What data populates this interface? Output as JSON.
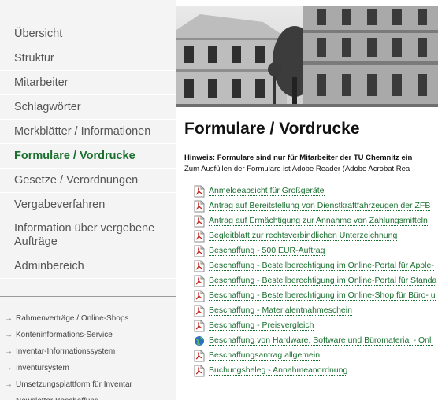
{
  "sidebar": {
    "nav": [
      {
        "label": "Übersicht",
        "active": false
      },
      {
        "label": "Struktur",
        "active": false
      },
      {
        "label": "Mitarbeiter",
        "active": false
      },
      {
        "label": "Schlagwörter",
        "active": false
      },
      {
        "label": "Merkblätter / Informationen",
        "active": false
      },
      {
        "label": "Formulare / Vordrucke",
        "active": true
      },
      {
        "label": "Gesetze / Verordnungen",
        "active": false
      },
      {
        "label": "Vergabeverfahren",
        "active": false
      },
      {
        "label": "Information über vergebene Aufträge",
        "active": false
      },
      {
        "label": "Adminbereich",
        "active": false
      }
    ],
    "links": [
      "Rahmenverträge / Online-Shops",
      "Konteninformations-Service",
      "Inventar-Informationssystem",
      "Inventursystem",
      "Umsetzungsplattform für Inventar",
      "Newsletter Beschaffung"
    ],
    "link_arrow": "→"
  },
  "main": {
    "title": "Formulare / Vordrucke",
    "notice_bold": "Hinweis: Formulare sind nur für Mitarbeiter der TU Chemnitz ein",
    "notice_text": "Zum Ausfüllen der Formulare ist Adobe Reader (Adobe Acrobat Rea",
    "forms": [
      {
        "label": "Anmeldeabsicht für Großgeräte",
        "icon": "pdf-icon"
      },
      {
        "label": "Antrag auf Bereitstellung von Dienstkraftfahrzeugen der ZFB",
        "icon": "pdf-icon"
      },
      {
        "label": "Antrag auf Ermächtigung zur Annahme von Zahlungsmitteln",
        "icon": "pdf-icon"
      },
      {
        "label": "Begleitblatt zur rechtsverbindlichen Unterzeichnung",
        "icon": "pdf-icon"
      },
      {
        "label": "Beschaffung - 500 EUR-Auftrag",
        "icon": "pdf-icon"
      },
      {
        "label": "Beschaffung - Bestellberechtigung im Online-Portal für Apple-",
        "icon": "pdf-icon"
      },
      {
        "label": "Beschaffung - Bestellberechtigung im Online-Portal für Standa",
        "icon": "pdf-icon"
      },
      {
        "label": "Beschaffung - Bestellberechtigung im Online-Shop für Büro- u",
        "icon": "pdf-icon"
      },
      {
        "label": "Beschaffung - Materialentnahmeschein",
        "icon": "pdf-icon"
      },
      {
        "label": "Beschaffung - Preisvergleich",
        "icon": "pdf-icon"
      },
      {
        "label": "Beschaffung von Hardware, Software und Büromaterial - Onli",
        "icon": "globe-icon"
      },
      {
        "label": "Beschaffungsantrag allgemein",
        "icon": "pdf-icon"
      },
      {
        "label": "Buchungsbeleg - Annahmeanordnung",
        "icon": "pdf-icon"
      }
    ]
  },
  "colors": {
    "accent": "#1a6f2f",
    "sidebar_bg": "#f4f4f4"
  }
}
